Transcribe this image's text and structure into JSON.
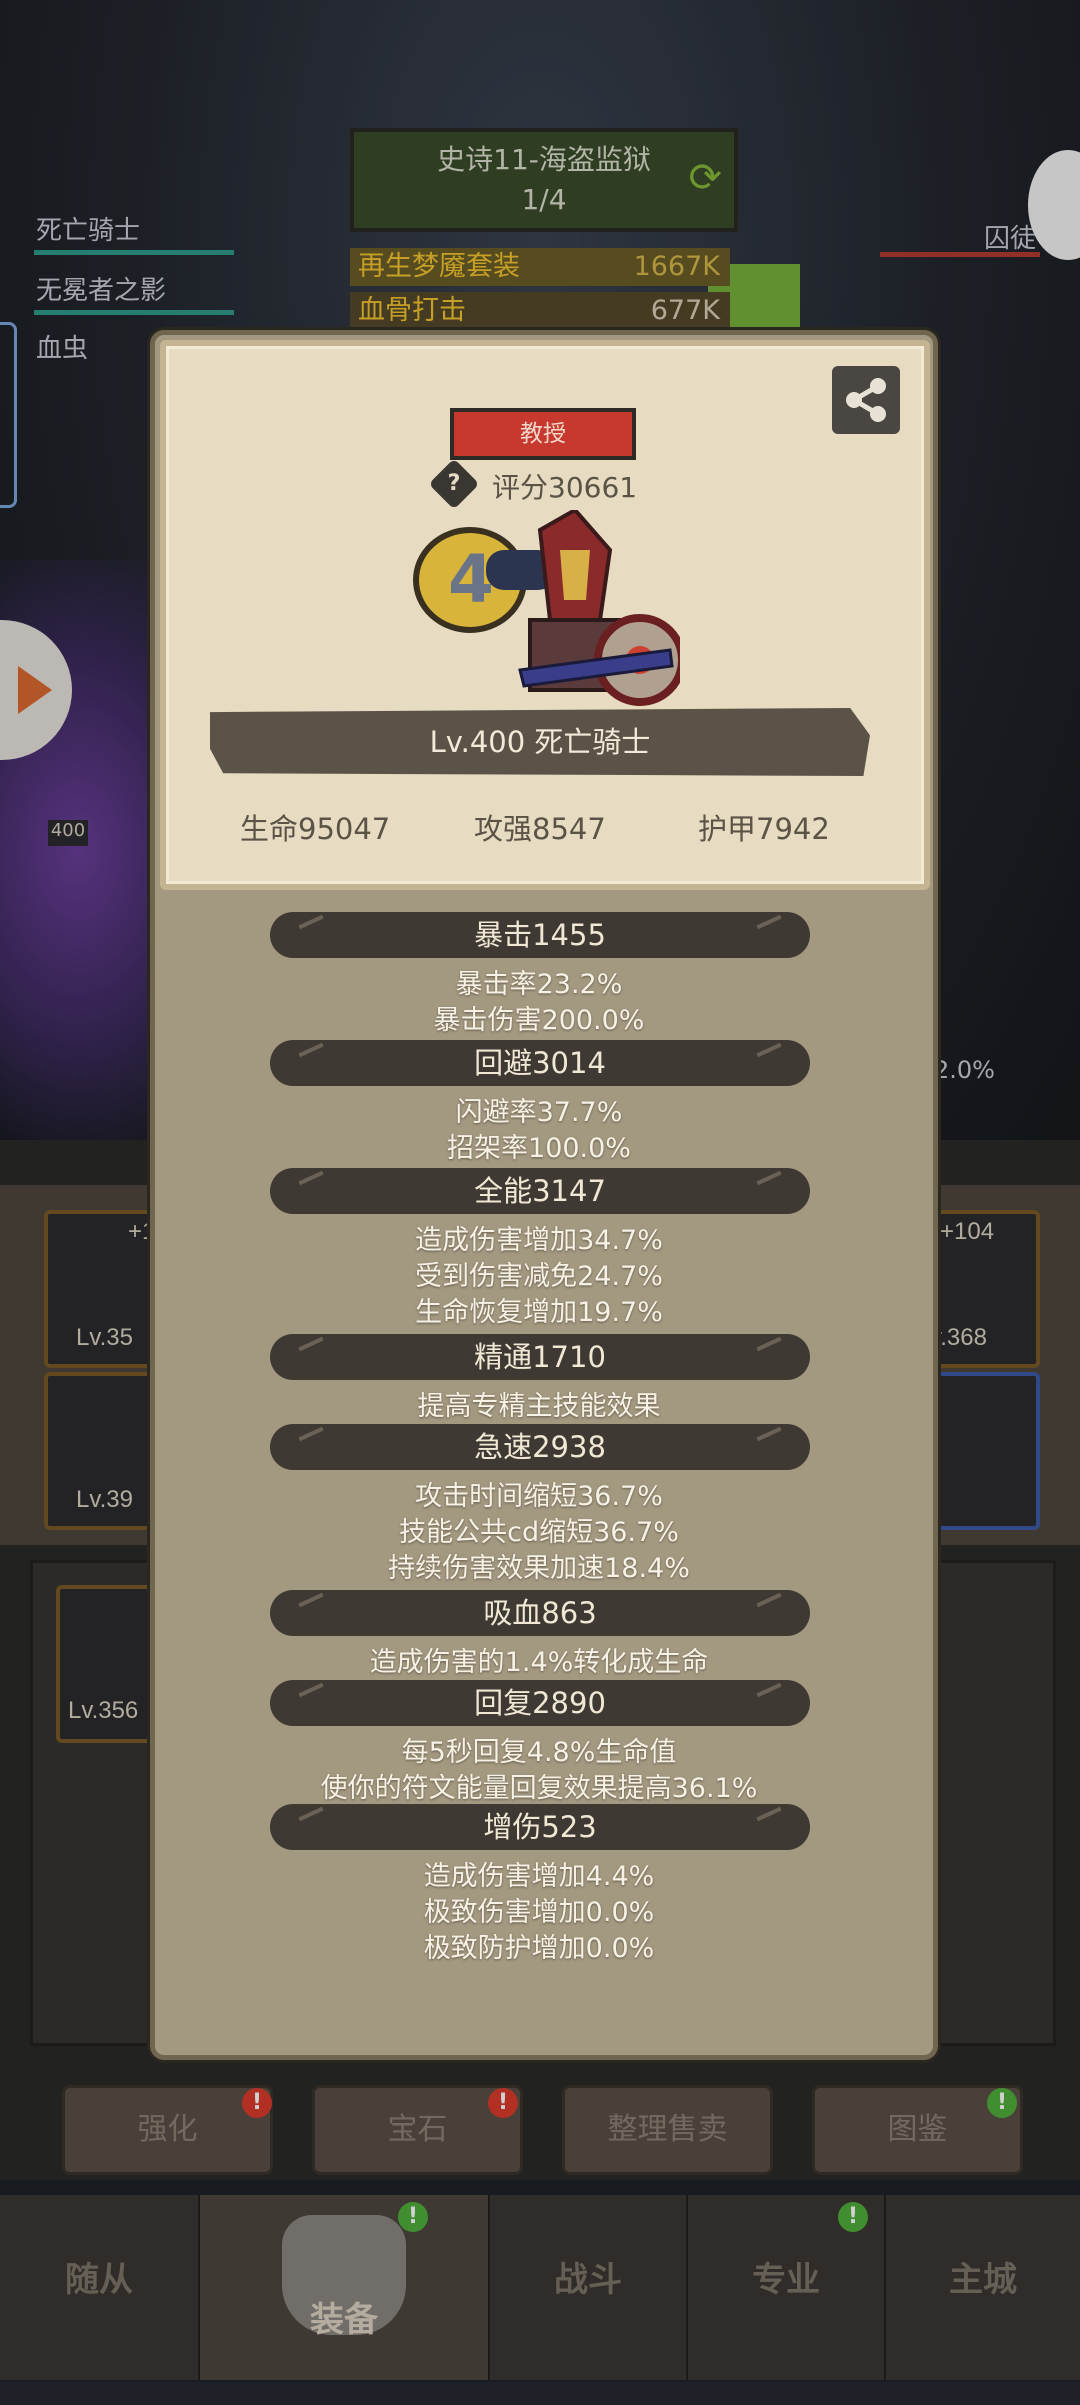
{
  "stage": {
    "title": "史诗11-海盗监狱",
    "progress_text": "1/4",
    "progress": 0.25
  },
  "team": {
    "members": [
      "死亡骑士",
      "无冕者之影",
      "血虫"
    ],
    "right_label": "囚徒"
  },
  "buffs": [
    {
      "name": "再生梦魇套装",
      "value": "1667K"
    },
    {
      "name": "血骨打击",
      "value": "677K"
    }
  ],
  "background": {
    "slots": [
      "+1",
      "Lv.35",
      "Lv.39",
      "+104",
      "v.368",
      "Lv.356"
    ],
    "pct": "2.0%",
    "level_badge": "400"
  },
  "hero": {
    "rank": "教授",
    "score": "评分30661",
    "name": "Lv.400 死亡骑士",
    "hp": "生命95047",
    "atk": "攻强8547",
    "armor": "护甲7942"
  },
  "stats": [
    {
      "header": "暴击1455",
      "lines": [
        "暴击率23.2%",
        "暴击伤害200.0%"
      ]
    },
    {
      "header": "回避3014",
      "lines": [
        "闪避率37.7%",
        "招架率100.0%"
      ]
    },
    {
      "header": "全能3147",
      "lines": [
        "造成伤害增加34.7%",
        "受到伤害减免24.7%",
        "生命恢复增加19.7%"
      ]
    },
    {
      "header": "精通1710",
      "lines": [
        "提高专精主技能效果"
      ]
    },
    {
      "header": "急速2938",
      "lines": [
        "攻击时间缩短36.7%",
        "技能公共cd缩短36.7%",
        "持续伤害效果加速18.4%"
      ]
    },
    {
      "header": "吸血863",
      "lines": [
        "造成伤害的1.4%转化成生命"
      ]
    },
    {
      "header": "回复2890",
      "lines": [
        "每5秒回复4.8%生命值",
        "使你的符文能量回复效果提高36.1%"
      ]
    },
    {
      "header": "增伤523",
      "lines": [
        "造成伤害增加4.4%",
        "极致伤害增加0.0%",
        "极致防护增加0.0%"
      ]
    }
  ],
  "actions": [
    "强化",
    "宝石",
    "整理售卖",
    "图鉴"
  ],
  "tabs": [
    "随从",
    "装备",
    "战斗",
    "专业",
    "主城"
  ],
  "colors": {
    "panel": "#a39880",
    "card": "#e7dcc2",
    "rank_red": "#c7382f",
    "header_dark": "#3e3932"
  }
}
